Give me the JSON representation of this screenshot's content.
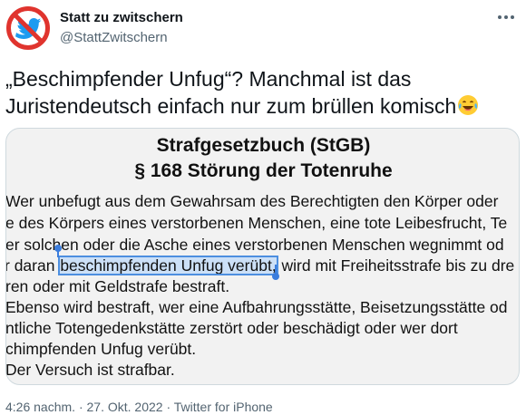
{
  "account": {
    "display_name": "Statt zu zwitschern",
    "handle": "@StattZwitschern",
    "avatar_icon": "crossed-out-bird-icon"
  },
  "tweet": {
    "text": "„Beschimpfender Unfug“? Manchmal ist das Juristendeutsch einfach nur zum brüllen komisch",
    "emoji": "laughing-crying-emoji"
  },
  "media": {
    "title_line1": "Strafgesetzbuch (StGB)",
    "title_line2": "§ 168 Störung der Totenruhe",
    "lines": [
      "Wer unbefugt aus dem Gewahrsam des Berechtigten den Körper oder",
      "e des Körpers eines verstorbenen Menschen, eine tote Leibesfrucht, Te",
      "er solchen oder die Asche eines verstorbenen Menschen wegnimmt od",
      "r daran",
      "beschimpfenden Unfug verübt,",
      " wird mit Freiheitsstrafe bis zu dre",
      "ren oder mit Geldstrafe bestraft.",
      "Ebenso wird bestraft, wer eine Aufbahrungsstätte, Beisetzungsstätte od",
      "ntliche Totengedenkstätte zerstört oder beschädigt oder wer dort",
      "chimpfenden Unfug verübt.",
      "Der Versuch ist strafbar."
    ]
  },
  "meta": {
    "time": "4:26 nachm.",
    "separator": "·",
    "date": "27. Okt. 2022",
    "source": "Twitter for iPhone"
  },
  "colors": {
    "text_primary": "#0f1419",
    "text_secondary": "#536471",
    "selection": "#cce0f7",
    "selection_handle": "#3b7ddd",
    "avatar_ring": "#e0342e",
    "bird_blue": "#1d9bf0"
  }
}
